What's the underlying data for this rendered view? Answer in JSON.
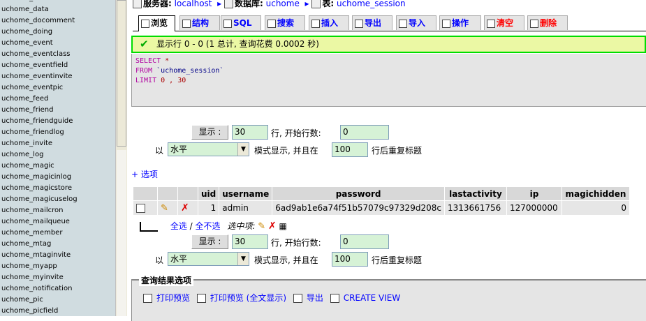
{
  "sidebar": {
    "items": [
      "uchome_cron",
      "uchome_data",
      "uchome_docomment",
      "uchome_doing",
      "uchome_event",
      "uchome_eventclass",
      "uchome_eventfield",
      "uchome_eventinvite",
      "uchome_eventpic",
      "uchome_feed",
      "uchome_friend",
      "uchome_friendguide",
      "uchome_friendlog",
      "uchome_invite",
      "uchome_log",
      "uchome_magic",
      "uchome_magicinlog",
      "uchome_magicstore",
      "uchome_magicuselog",
      "uchome_mailcron",
      "uchome_mailqueue",
      "uchome_member",
      "uchome_mtag",
      "uchome_mtaginvite",
      "uchome_myapp",
      "uchome_myinvite",
      "uchome_notification",
      "uchome_pic",
      "uchome_picfield"
    ]
  },
  "breadcrumb": {
    "server_label": "服务器:",
    "server": "localhost",
    "db_label": "数据库:",
    "db": "uchome",
    "table_label": "表:",
    "table": "uchome_session"
  },
  "tabs": [
    {
      "label": "浏览",
      "icon": "browse-icon"
    },
    {
      "label": "结构",
      "icon": "structure-icon"
    },
    {
      "label": "SQL",
      "icon": "sql-icon"
    },
    {
      "label": "搜索",
      "icon": "search-icon"
    },
    {
      "label": "插入",
      "icon": "insert-icon"
    },
    {
      "label": "导出",
      "icon": "export-icon"
    },
    {
      "label": "导入",
      "icon": "import-icon"
    },
    {
      "label": "操作",
      "icon": "operations-icon"
    },
    {
      "label": "清空",
      "icon": "empty-icon"
    },
    {
      "label": "删除",
      "icon": "drop-icon"
    }
  ],
  "success_message": "显示行 0 - 0 (1 总计, 查询花费 0.0002 秒)",
  "sql": {
    "line1_kw": "SELECT",
    "line1_rest": " *",
    "line2_kw": "FROM",
    "line2_rest": " `uchome_session`",
    "line3_kw": "LIMIT",
    "line3_rest": " 0 , 30"
  },
  "nav": {
    "show_button": "显示 :",
    "rows": "30",
    "rows_label": "行, 开始行数:",
    "start": "0",
    "mode_prefix": "以",
    "mode": "水平",
    "mode_label": "模式显示, 并且在",
    "repeat": "100",
    "repeat_label": "行后重复标题"
  },
  "options_link": "+ 选项",
  "table": {
    "headers": [
      "uid",
      "username",
      "password",
      "lastactivity",
      "ip",
      "magichidden"
    ],
    "rows": [
      [
        "1",
        "admin",
        "6ad9ab1e6a74f51b57079c97329d208c",
        "1313661756",
        "127000000",
        "0"
      ]
    ]
  },
  "selection": {
    "check_all": "全选",
    "separator": " / ",
    "uncheck_all": "全不选",
    "with_selected": "选中项:"
  },
  "query_results": {
    "title": "查询结果选项",
    "print": "打印预览",
    "print_full": "打印预览 (全文显示)",
    "export": "导出",
    "create_view": "CREATE VIEW"
  }
}
